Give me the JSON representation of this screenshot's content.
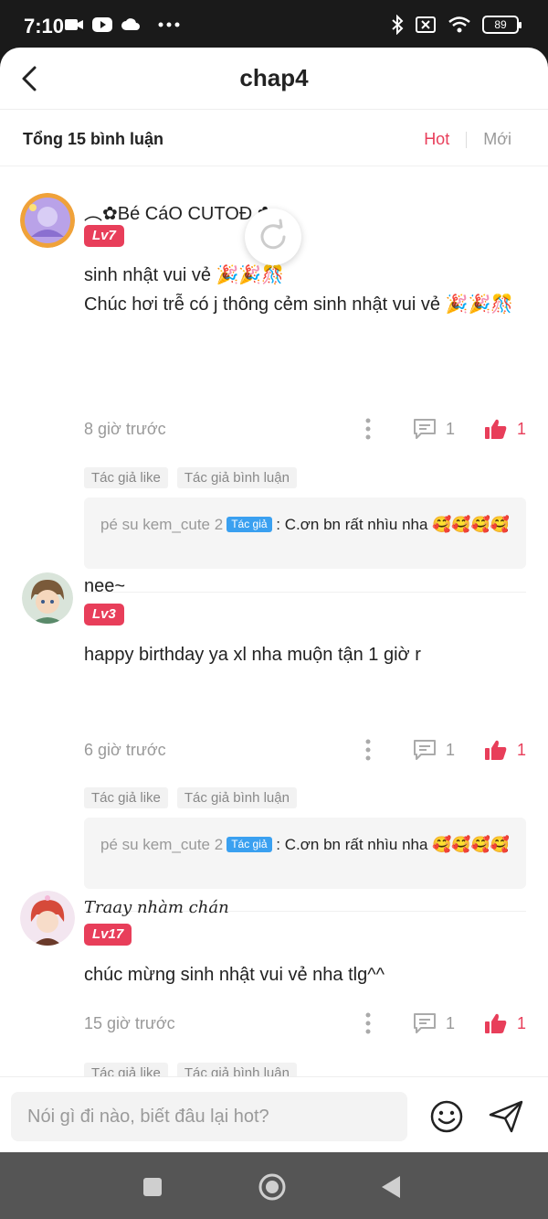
{
  "status_bar": {
    "time": "7:10",
    "battery": "89"
  },
  "header": {
    "title": "chap4"
  },
  "subheader": {
    "count_label": "Tổng 15 bình luận",
    "tabs": [
      "Hot",
      "Mới"
    ],
    "active_tab": "Hot"
  },
  "comments": [
    {
      "username": "︵✿Bé CáO CUTOĐ ✿",
      "level": "Lv7",
      "text_line1": "sinh nhật vui vẻ 🎉🎉🎊",
      "text_line2": "Chúc hơi trễ có j thông cẻm sinh nhật vui vẻ 🎉🎉🎊",
      "time": "8 giờ trước",
      "reply_count": "1",
      "like_count": "1",
      "tags": [
        "Tác giả like",
        "Tác giả bình luận"
      ],
      "reply": {
        "author": "pé su kem_cute 2",
        "badge": "Tác giả",
        "text": ": C.ơn bn rất nhìu nha 🥰🥰🥰🥰"
      }
    },
    {
      "username": "nee~",
      "level": "Lv3",
      "text_line1": "happy birthday ya xl nha muộn tận 1 giờ r",
      "time": "6 giờ trước",
      "reply_count": "1",
      "like_count": "1",
      "tags": [
        "Tác giả like",
        "Tác giả bình luận"
      ],
      "reply": {
        "author": "pé su kem_cute 2",
        "badge": "Tác giả",
        "text": ": C.ơn bn rất nhìu nha 🥰🥰🥰🥰"
      }
    },
    {
      "username": "Traay nhàm chán",
      "level": "Lv17",
      "text_line1": "chúc mừng sinh nhật vui vẻ nha tlg^^",
      "time": "15 giờ trước",
      "reply_count": "1",
      "like_count": "1",
      "tags": [
        "Tác giả like",
        "Tác giả bình luận"
      ]
    }
  ],
  "input": {
    "placeholder": "Nói gì đi nào, biết đâu lại hot?"
  },
  "colors": {
    "accent": "#e83e5a",
    "badge_blue": "#3aa0f0"
  },
  "icons": [
    "back-icon",
    "more-icon",
    "comment-icon",
    "like-icon",
    "emoji-icon",
    "send-icon",
    "refresh-icon",
    "recent-apps-icon",
    "home-icon",
    "back-nav-icon"
  ]
}
